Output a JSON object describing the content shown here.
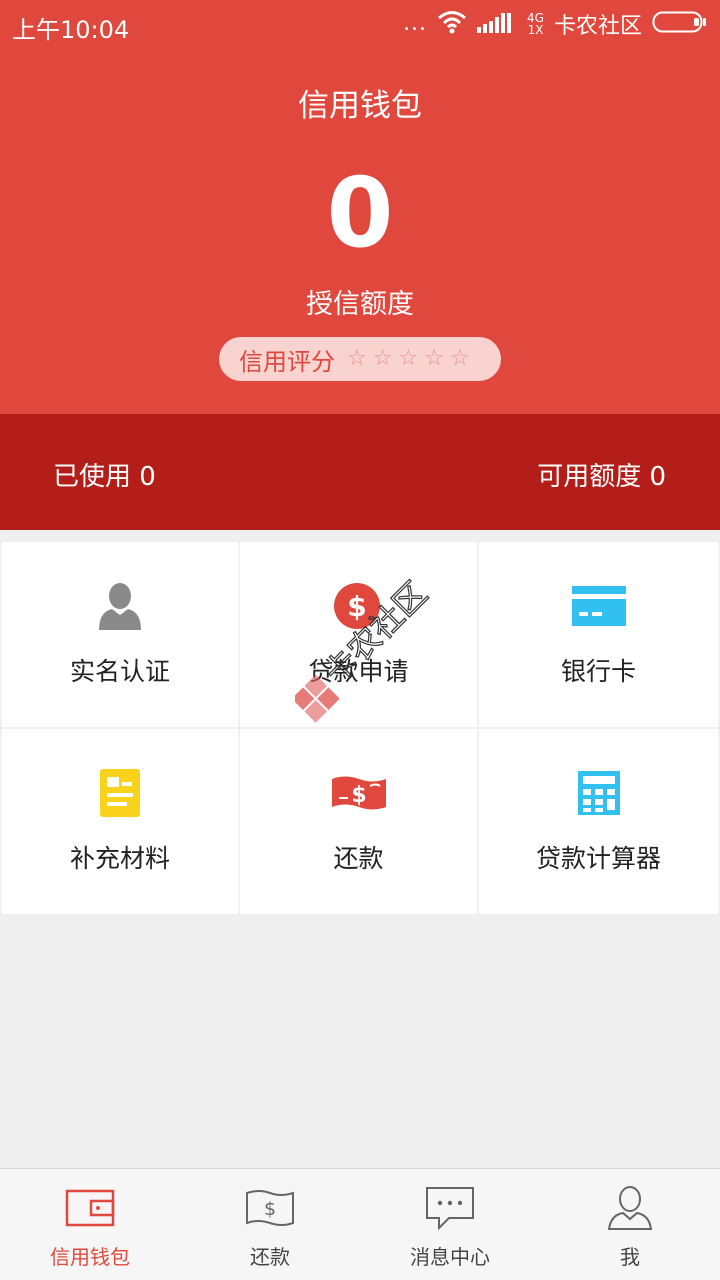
{
  "status_bar": {
    "time": "上午10:04",
    "dots": "...",
    "network_top": "4G",
    "network_bottom": "1X",
    "carrier": "卡农社区"
  },
  "header": {
    "title": "信用钱包",
    "credit_amount": "0",
    "credit_label": "授信额度",
    "score_label": "信用评分",
    "score_stars": 0,
    "score_max": 5
  },
  "usage": {
    "used": "已使用 0",
    "available": "可用额度 0"
  },
  "grid": [
    {
      "label": "实名认证",
      "icon": "user-icon"
    },
    {
      "label": "贷款申请",
      "icon": "dollar-coin-icon"
    },
    {
      "label": "银行卡",
      "icon": "bank-card-icon"
    },
    {
      "label": "补充材料",
      "icon": "document-icon"
    },
    {
      "label": "还款",
      "icon": "cash-icon"
    },
    {
      "label": "贷款计算器",
      "icon": "calculator-icon"
    }
  ],
  "watermark": "卡农社区",
  "tabs": [
    {
      "label": "信用钱包",
      "icon": "wallet-icon",
      "active": true
    },
    {
      "label": "还款",
      "icon": "bill-icon",
      "active": false
    },
    {
      "label": "消息中心",
      "icon": "message-icon",
      "active": false
    },
    {
      "label": "我",
      "icon": "profile-icon",
      "active": false
    }
  ],
  "colors": {
    "primary": "#e0483e",
    "dark_red": "#b41e19",
    "background": "#efefef",
    "accent_blue": "#31c0f0",
    "accent_yellow": "#f9d21b"
  }
}
